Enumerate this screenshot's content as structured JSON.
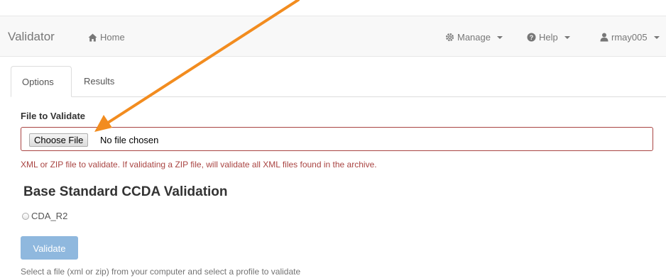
{
  "navbar": {
    "brand": "Validator",
    "home_label": "Home",
    "manage_label": "Manage",
    "help_label": "Help",
    "user_label": "rmay005"
  },
  "tabs": [
    {
      "label": "Options",
      "active": true
    },
    {
      "label": "Results",
      "active": false
    }
  ],
  "form": {
    "file_label": "File to Validate",
    "choose_file_label": "Choose File",
    "file_status": "No file chosen",
    "file_help": "XML or ZIP file to validate. If validating a ZIP file, will validate all XML files found in the archive."
  },
  "section": {
    "title": "Base Standard CCDA Validation",
    "options": [
      {
        "label": "CDA_R2",
        "selected": false
      }
    ]
  },
  "actions": {
    "validate_label": "Validate",
    "instruction": "Select a file (xml or zip) from your computer and select a profile to validate"
  },
  "annotation": {
    "arrow_color": "#f28c1f",
    "error_color": "#a94442",
    "button_color": "#8fb8de"
  }
}
